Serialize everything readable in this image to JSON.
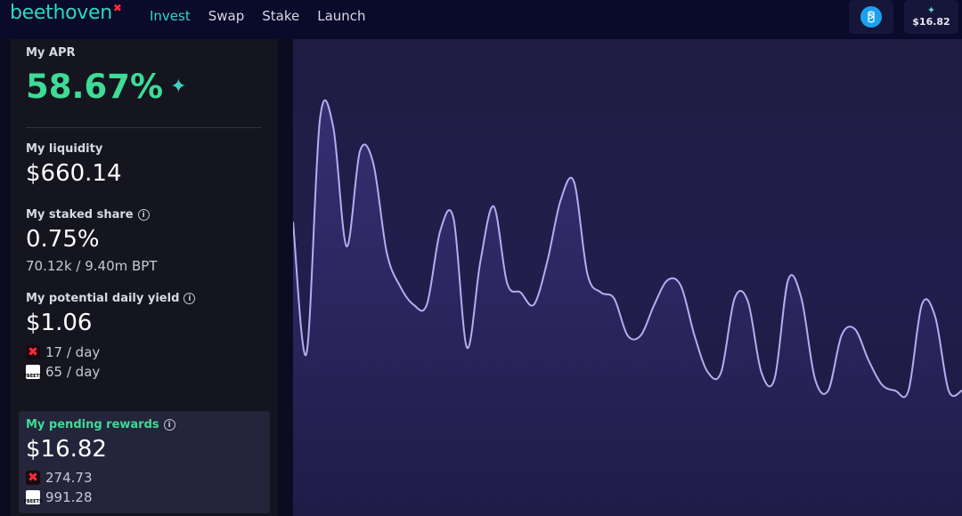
{
  "header": {
    "logo_text": "beethoven",
    "logo_mark": "✖",
    "nav": [
      {
        "label": "Invest",
        "active": true
      },
      {
        "label": "Swap",
        "active": false
      },
      {
        "label": "Stake",
        "active": false
      },
      {
        "label": "Launch",
        "active": false
      }
    ],
    "network_icon": "fantom-icon",
    "rewards_icon": "sparkles-icon",
    "rewards_amount": "$16.82"
  },
  "stats": {
    "apr_label": "My APR",
    "apr_value": "58.67%",
    "liquidity_label": "My liquidity",
    "liquidity_value": "$660.14",
    "staked_label": "My staked share",
    "staked_value": "0.75%",
    "staked_detail": "70.12k / 9.40m BPT",
    "yield_label": "My potential daily yield",
    "yield_value": "$1.06",
    "yield_tokens": [
      {
        "icon": "beets-token-icon",
        "text": "17 / day"
      },
      {
        "icon": "fbeets-token-icon",
        "text": "65 / day"
      }
    ],
    "pending_label": "My pending rewards",
    "pending_value": "$16.82",
    "pending_tokens": [
      {
        "icon": "beets-token-icon",
        "text": "274.73"
      },
      {
        "icon": "fbeets-token-icon",
        "text": "991.28"
      }
    ]
  },
  "colors": {
    "accent_teal": "#33d6c6",
    "apr_green": "#3ddc97",
    "chart_line": "#b4aef0"
  },
  "chart_data": {
    "type": "area",
    "x": [
      0,
      1,
      2,
      3,
      4,
      5,
      6,
      7,
      8,
      9,
      10,
      11,
      12,
      13,
      14,
      15,
      16,
      17,
      18,
      19,
      20,
      21,
      22,
      23,
      24,
      25,
      26,
      27,
      28,
      29,
      30,
      31,
      32,
      33,
      34,
      35,
      36,
      37,
      38,
      39,
      40,
      41,
      42,
      43,
      44,
      45,
      46,
      47,
      48,
      49,
      50
    ],
    "values": [
      0.55,
      0.12,
      0.88,
      0.86,
      0.47,
      0.78,
      0.74,
      0.45,
      0.34,
      0.28,
      0.28,
      0.52,
      0.56,
      0.14,
      0.42,
      0.6,
      0.35,
      0.32,
      0.28,
      0.42,
      0.62,
      0.68,
      0.38,
      0.32,
      0.3,
      0.18,
      0.18,
      0.28,
      0.36,
      0.34,
      0.18,
      0.06,
      0.06,
      0.3,
      0.29,
      0.06,
      0.04,
      0.36,
      0.3,
      0.04,
      0.0,
      0.18,
      0.2,
      0.1,
      0.02,
      0.0,
      0.0,
      0.28,
      0.24,
      0.0,
      0.0
    ],
    "title": "",
    "xlabel": "",
    "ylabel": "",
    "grid": false,
    "legend": "none"
  }
}
